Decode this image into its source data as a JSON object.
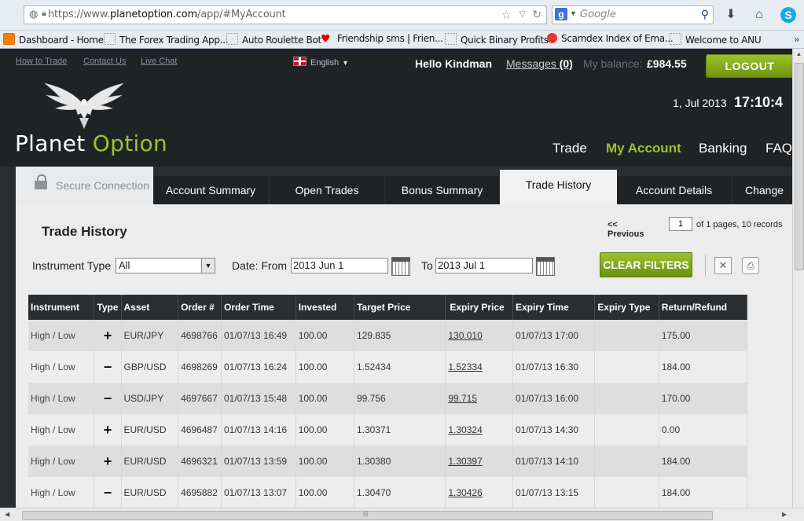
{
  "browser": {
    "url_scheme": "https://www.",
    "url_domain": "planetoption.com",
    "url_path": "/app/#MyAccount",
    "search_engine_placeholder": "Google",
    "bookmarks": [
      {
        "label": "Dashboard - Home",
        "icon": "blogger-icon"
      },
      {
        "label": "The Forex Trading App...",
        "icon": "page-icon"
      },
      {
        "label": "Auto Roulette Bot",
        "icon": "page-icon"
      },
      {
        "label": "Friendship sms | Frien...",
        "icon": "heart-icon"
      },
      {
        "label": "Quick Binary Profits",
        "icon": "page-icon"
      },
      {
        "label": "Scamdex Index of Ema...",
        "icon": "noentry-icon"
      },
      {
        "label": "Welcome to ANU",
        "icon": "page-icon"
      }
    ]
  },
  "site": {
    "toplinks": [
      "How to Trade",
      "Contact Us",
      "Live Chat"
    ],
    "language": "English",
    "greeting": "Hello Kindman",
    "messages_label": "Messages",
    "messages_count": "(0)",
    "balance_label": "My balance:",
    "balance_value": "£984.55",
    "logout_label": "LOGOUT",
    "brand_part1": "Planet",
    "brand_part2": "Option",
    "date": "1, Jul 2013",
    "time": "17:10:4",
    "nav": [
      "Trade",
      "My Account",
      "Banking",
      "FAQ"
    ],
    "nav_active": "My Account"
  },
  "tabs": {
    "secure_label": "Secure Connection",
    "items": [
      "Account Summary",
      "Open Trades",
      "Bonus Summary",
      "Trade History",
      "Account Details",
      "Change P"
    ],
    "active": "Trade History"
  },
  "history": {
    "title": "Trade History",
    "prev_label": "<< Previous",
    "page_value": "1",
    "page_info": "of 1 pages, 10 records",
    "instrument_type_label": "Instrument Type",
    "instrument_type_value": "All",
    "date_from_label": "Date: From",
    "date_from_value": "2013 Jun 1",
    "date_to_label": "To",
    "date_to_value": "2013 Jul 1",
    "clear_filters_label": "CLEAR FILTERS",
    "columns": [
      "Instrument",
      "Type",
      "Asset",
      "Order #",
      "Order Time",
      "Invested",
      "Target Price",
      "Expiry Price",
      "Expiry Time",
      "Expiry Type",
      "Return/Refund"
    ],
    "rows": [
      {
        "instrument": "High / Low",
        "type": "+",
        "asset": "EUR/JPY",
        "order": "4698766",
        "order_time": "01/07/13 16:49",
        "invested": "100.00",
        "target": "129.835",
        "expiry_price": "130.010",
        "expiry_time": "01/07/13 17:00",
        "expiry_type": "",
        "return": "175.00"
      },
      {
        "instrument": "High / Low",
        "type": "−",
        "asset": "GBP/USD",
        "order": "4698269",
        "order_time": "01/07/13 16:24",
        "invested": "100.00",
        "target": "1.52434",
        "expiry_price": "1.52334",
        "expiry_time": "01/07/13 16:30",
        "expiry_type": "",
        "return": "184.00"
      },
      {
        "instrument": "High / Low",
        "type": "−",
        "asset": "USD/JPY",
        "order": "4697667",
        "order_time": "01/07/13 15:48",
        "invested": "100.00",
        "target": "99.756",
        "expiry_price": "99.715",
        "expiry_time": "01/07/13 16:00",
        "expiry_type": "",
        "return": "170.00"
      },
      {
        "instrument": "High / Low",
        "type": "+",
        "asset": "EUR/USD",
        "order": "4696487",
        "order_time": "01/07/13 14:16",
        "invested": "100.00",
        "target": "1.30371",
        "expiry_price": "1.30324",
        "expiry_time": "01/07/13 14:30",
        "expiry_type": "",
        "return": "0.00"
      },
      {
        "instrument": "High / Low",
        "type": "+",
        "asset": "EUR/USD",
        "order": "4696321",
        "order_time": "01/07/13 13:59",
        "invested": "100.00",
        "target": "1.30380",
        "expiry_price": "1.30397",
        "expiry_time": "01/07/13 14:10",
        "expiry_type": "",
        "return": "184.00"
      },
      {
        "instrument": "High / Low",
        "type": "−",
        "asset": "EUR/USD",
        "order": "4695882",
        "order_time": "01/07/13 13:07",
        "invested": "100.00",
        "target": "1.30470",
        "expiry_price": "1.30426",
        "expiry_time": "01/07/13 13:15",
        "expiry_type": "",
        "return": "184.00"
      }
    ]
  },
  "colors": {
    "accent_green": "#9bc22b",
    "header_dark": "#1f2326",
    "band_dark": "#2b2e31"
  }
}
